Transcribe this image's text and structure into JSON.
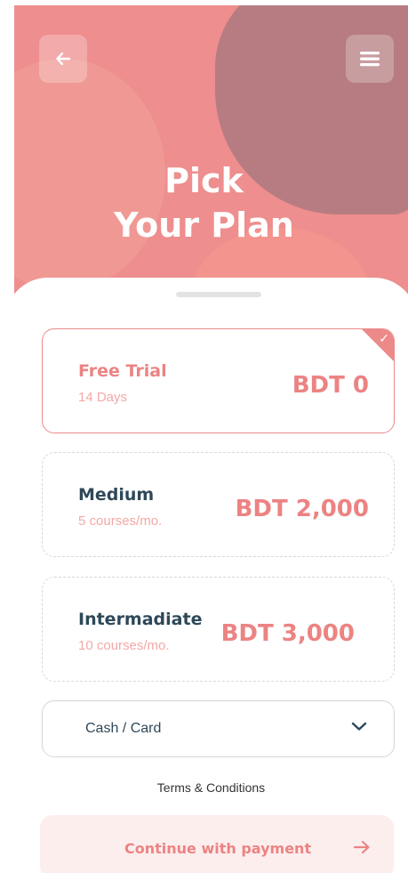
{
  "header": {
    "title_line1": "Pick",
    "title_line2": "Your Plan"
  },
  "plans": [
    {
      "name": "Free Trial",
      "subtitle": "14 Days",
      "price": "BDT 0",
      "selected": true
    },
    {
      "name": "Medium",
      "subtitle": "5 courses/mo.",
      "price": "BDT 2,000",
      "selected": false
    },
    {
      "name": "Intermadiate",
      "subtitle": "10 courses/mo.",
      "price": "BDT 3,000",
      "selected": false
    }
  ],
  "payment": {
    "selected_value": "Cash / Card"
  },
  "footer": {
    "terms_label": "Terms & Conditions",
    "continue_label": "Continue with payment"
  },
  "icons": {
    "back": "arrow-left-icon",
    "menu": "hamburger-menu-icon",
    "check": "check-icon",
    "dropdown": "chevron-down-icon",
    "continue": "arrow-right-icon"
  },
  "colors": {
    "hero_background": "#ee8e8e",
    "hero_blob_dark": "#b67c81",
    "accent": "#ec8383",
    "plan_name_dark": "#2f4858",
    "continue_background": "#fdeeee"
  }
}
